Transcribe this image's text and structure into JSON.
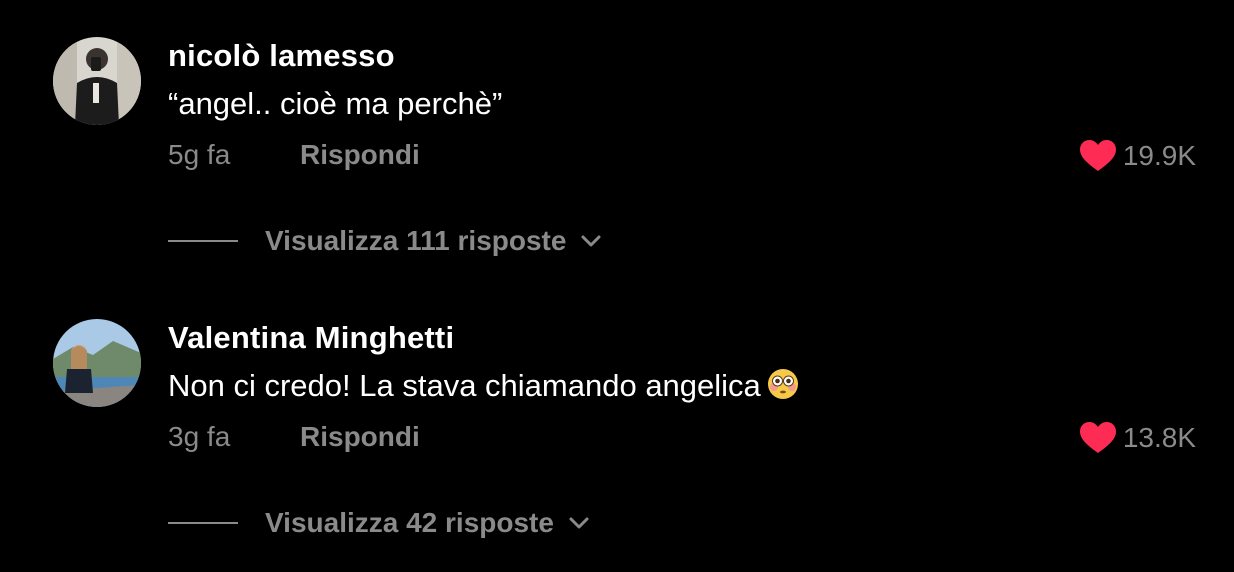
{
  "colors": {
    "background": "#000000",
    "primary_text": "#ffffff",
    "secondary_text": "#8a8a8a",
    "heart": "#fe2c55"
  },
  "comments": [
    {
      "username": "nicolò lamesso",
      "text": "“angel.. cioè ma perchè”",
      "time": "5g fa",
      "reply_label": "Rispondi",
      "likes": "19.9K",
      "view_replies_label": "Visualizza 111 risposte",
      "avatar_icon": "avatar-photo",
      "liked": true
    },
    {
      "username": "Valentina Minghetti",
      "text": "Non ci credo! La stava chiamando angelica",
      "emoji": "flushed-face-emoji",
      "time": "3g fa",
      "reply_label": "Rispondi",
      "likes": "13.8K",
      "view_replies_label": "Visualizza 42 risposte",
      "avatar_icon": "avatar-photo",
      "liked": true
    }
  ]
}
